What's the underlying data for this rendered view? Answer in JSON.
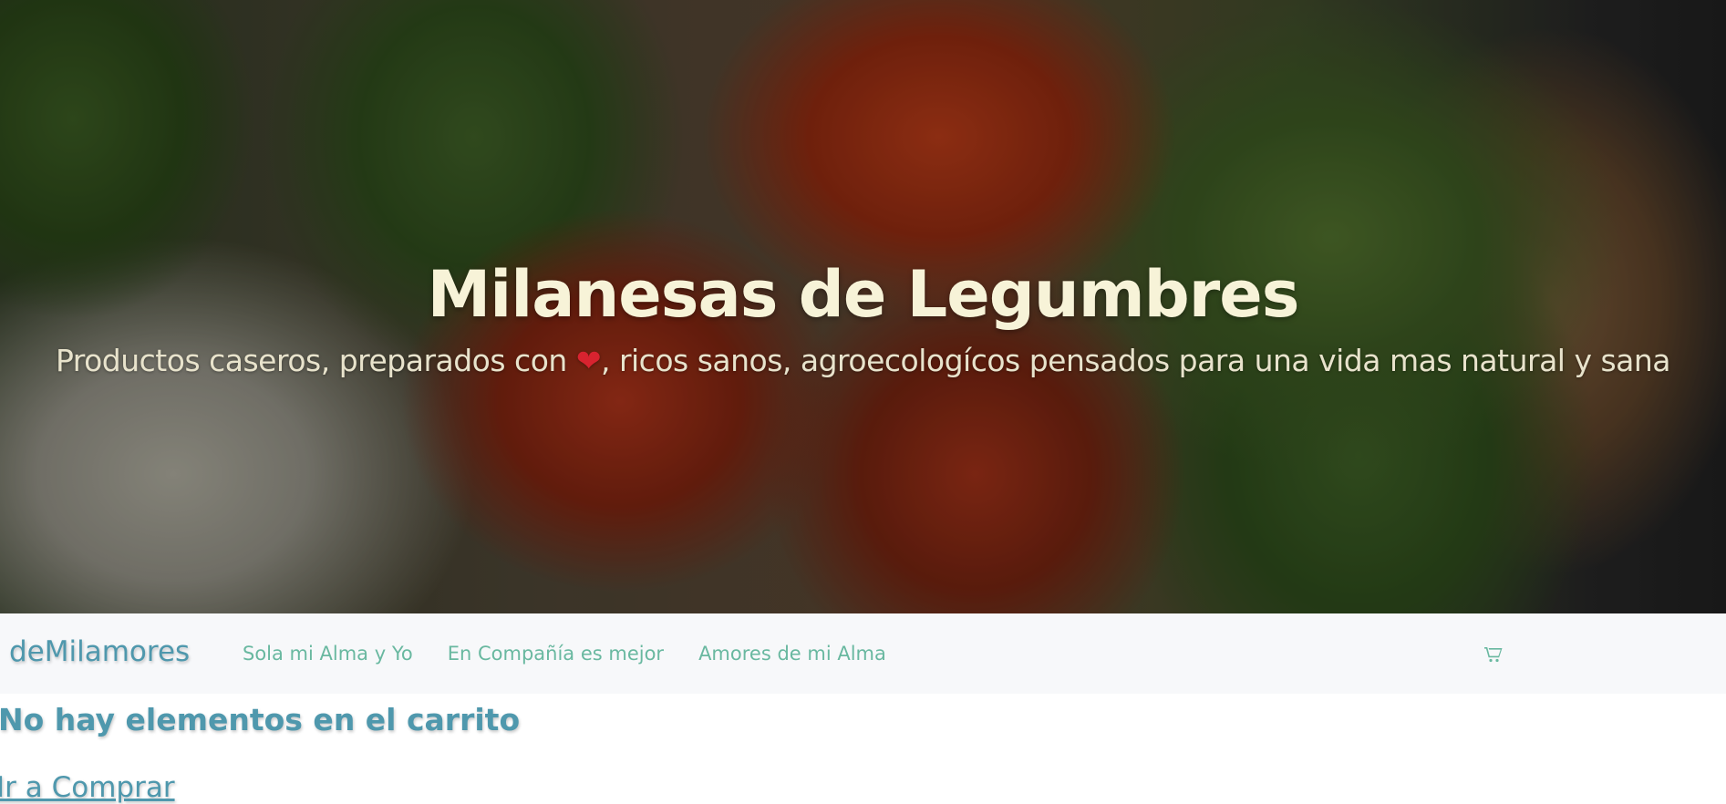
{
  "hero": {
    "title": "Milanesas de Legumbres",
    "subtitle_before": "Productos caseros, preparados con ",
    "subtitle_icon": "heart-icon",
    "subtitle_after": ", ricos sanos, agroecologícos pensados para una vida mas natural y sana"
  },
  "navbar": {
    "brand": "deMilamores",
    "links": [
      {
        "label": "Sola mi Alma y Yo"
      },
      {
        "label": "En Compañía es mejor"
      },
      {
        "label": "Amores de mi Alma"
      }
    ],
    "cart_icon": "shopping-cart-icon"
  },
  "cart": {
    "empty_message": "No hay elementos en el carrito",
    "shop_link": "Ir a Comprar"
  },
  "colors": {
    "title": "#f7f3d8",
    "brand": "#4f98ad",
    "nav_link": "#69b8a0",
    "navbar_bg": "#f7f8fa",
    "heart": "#d8232f"
  }
}
